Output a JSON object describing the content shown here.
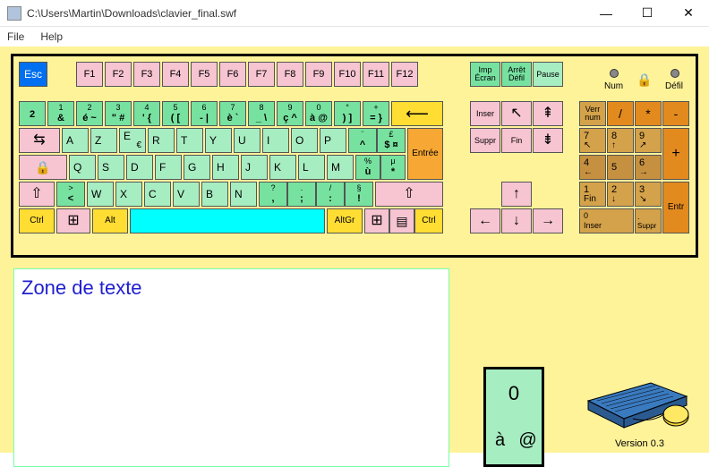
{
  "window": {
    "title": "C:\\Users\\Martin\\Downloads\\clavier_final.swf",
    "min": "—",
    "max": "☐",
    "close": "✕"
  },
  "menu": {
    "file": "File",
    "help": "Help"
  },
  "esc": "Esc",
  "frow": [
    "F1",
    "F2",
    "F3",
    "F4",
    "F5",
    "F6",
    "F7",
    "F8",
    "F9",
    "F10",
    "F11",
    "F12"
  ],
  "sys": {
    "print": "Imp\nÉcran",
    "scroll": "Arrêt\nDéfil",
    "pause": "Pause"
  },
  "leds": {
    "num": "Num",
    "defil": "Défil"
  },
  "row1": [
    {
      "t": "",
      "b": "2"
    },
    {
      "t": "1",
      "b": "&"
    },
    {
      "t": "2",
      "b": "é ~"
    },
    {
      "t": "3",
      "b": "\" #"
    },
    {
      "t": "4",
      "b": "' {"
    },
    {
      "t": "5",
      "b": "( ["
    },
    {
      "t": "6",
      "b": "- |"
    },
    {
      "t": "7",
      "b": "è `"
    },
    {
      "t": "8",
      "b": "_ \\"
    },
    {
      "t": "9",
      "b": "ç ^"
    },
    {
      "t": "0",
      "b": "à @"
    },
    {
      "t": "°",
      "b": ") ]"
    },
    {
      "t": "+",
      "b": "= }"
    }
  ],
  "row2": {
    "tab": "⇆",
    "keys": [
      "A",
      "Z",
      "E",
      "R",
      "T",
      "Y",
      "U",
      "I",
      "O",
      "P"
    ],
    "extra1": {
      "t": "¨",
      "b": "^"
    },
    "extra2": {
      "t": "£",
      "b": "$ ¤"
    },
    "enter": "Entrée",
    "euro": "€"
  },
  "row3": {
    "caps": "🔒",
    "keys": [
      "Q",
      "S",
      "D",
      "F",
      "G",
      "H",
      "J",
      "K",
      "L",
      "M"
    ],
    "extra1": {
      "t": "%",
      "b": "ù"
    },
    "extra2": {
      "t": "μ",
      "b": "*"
    }
  },
  "row4": {
    "shiftL": "⇧",
    "less": {
      "t": ">",
      "b": "<"
    },
    "keys": [
      "W",
      "X",
      "C",
      "V",
      "B",
      "N"
    ],
    "comma": {
      "t": "?",
      "b": ","
    },
    "semi": {
      "t": ".",
      "b": ";"
    },
    "colon": {
      "t": "/",
      "b": ":"
    },
    "excl": {
      "t": "§",
      "b": "!"
    },
    "shiftR": "⇧"
  },
  "row5": {
    "ctrlL": "Ctrl",
    "winL": "⊞",
    "alt": "Alt",
    "altgr": "AltGr",
    "winR": "⊞",
    "menu": "▤",
    "ctrlR": "Ctrl"
  },
  "nav": {
    "inser": "Inser",
    "home": "↖",
    "pgup": "⇞",
    "suppr": "Suppr",
    "fin": "Fin",
    "pgdn": "⇟"
  },
  "arrows": {
    "up": "↑",
    "left": "←",
    "down": "↓",
    "right": "→"
  },
  "numpad": {
    "verr": "Verr\nnum",
    "div": "/",
    "mul": "*",
    "sub": "-",
    "r2": [
      {
        "t": "7",
        "b": "↖"
      },
      {
        "t": "8",
        "b": "↑"
      },
      {
        "t": "9",
        "b": "↗"
      }
    ],
    "add": "+",
    "r3": [
      {
        "t": "4",
        "b": "←"
      },
      {
        "t": "5",
        "b": ""
      },
      {
        "t": "6",
        "b": "→"
      }
    ],
    "r4": [
      {
        "t": "1",
        "b": "Fin"
      },
      {
        "t": "2",
        "b": "↓"
      },
      {
        "t": "3",
        "b": "↘"
      }
    ],
    "entr": "Entr",
    "r5a": {
      "t": "0",
      "b": "Inser"
    },
    "r5b": {
      "t": ".",
      "b": "Suppr"
    }
  },
  "textbox": "Zone de texte",
  "bigkey": {
    "top": "0",
    "bl": "à",
    "br": "@"
  },
  "version": "Version 0.3"
}
